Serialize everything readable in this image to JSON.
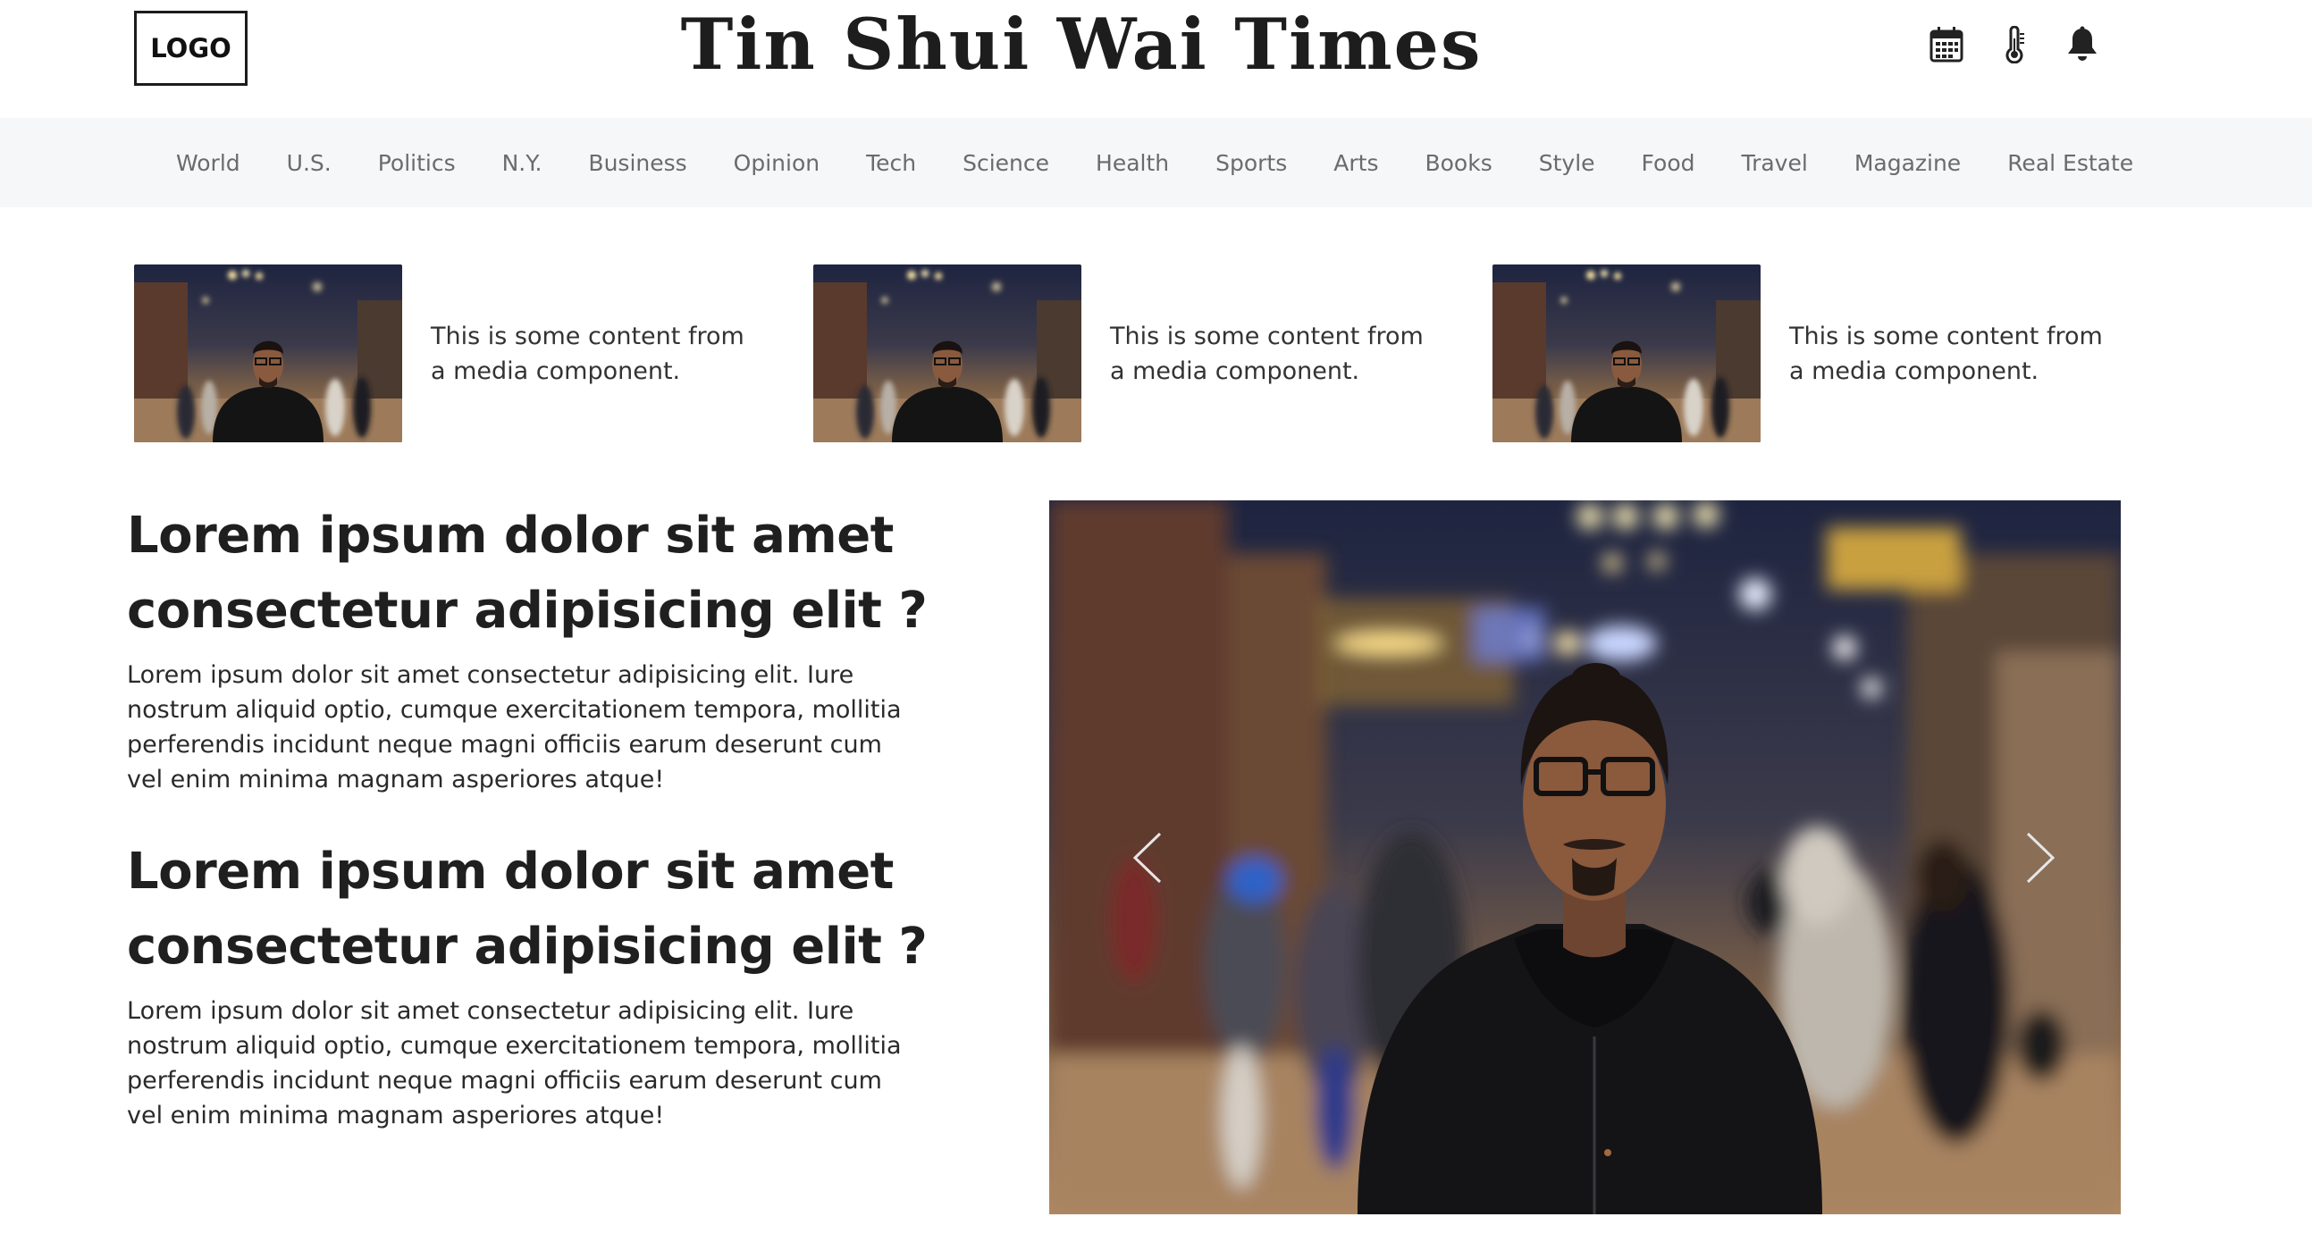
{
  "header": {
    "logo_text": "LOGO",
    "site_title": "Tin Shui Wai Times",
    "icons": [
      "calendar-icon",
      "thermometer-icon",
      "bell-icon"
    ]
  },
  "nav": {
    "items": [
      "World",
      "U.S.",
      "Politics",
      "N.Y.",
      "Business",
      "Opinion",
      "Tech",
      "Science",
      "Health",
      "Sports",
      "Arts",
      "Books",
      "Style",
      "Food",
      "Travel",
      "Magazine",
      "Real Estate"
    ]
  },
  "media_items": [
    {
      "text": "This is some content from a media component."
    },
    {
      "text": "This is some content from a media component."
    },
    {
      "text": "This is some content from a media component."
    }
  ],
  "articles": [
    {
      "title": "Lorem ipsum dolor sit amet consectetur adipisicing elit ?",
      "body": "Lorem ipsum dolor sit amet consectetur adipisicing elit. Iure nostrum aliquid optio, cumque exercitationem tempora, mollitia perferendis incidunt neque magni officiis earum deserunt cum vel enim minima magnam asperiores atque!"
    },
    {
      "title": "Lorem ipsum dolor sit amet consectetur adipisicing elit ?",
      "body": "Lorem ipsum dolor sit amet consectetur adipisicing elit. Iure nostrum aliquid optio, cumque exercitationem tempora, mollitia perferendis incidunt neque magni officiis earum deserunt cum vel enim minima magnam asperiores atque!"
    }
  ],
  "carousel": {
    "prev_icon": "chevron-left-icon",
    "next_icon": "chevron-right-icon"
  },
  "colors": {
    "nav_bg": "#f6f7f8",
    "nav_text": "#6b6b6b",
    "title_text": "#1d1d1d"
  }
}
